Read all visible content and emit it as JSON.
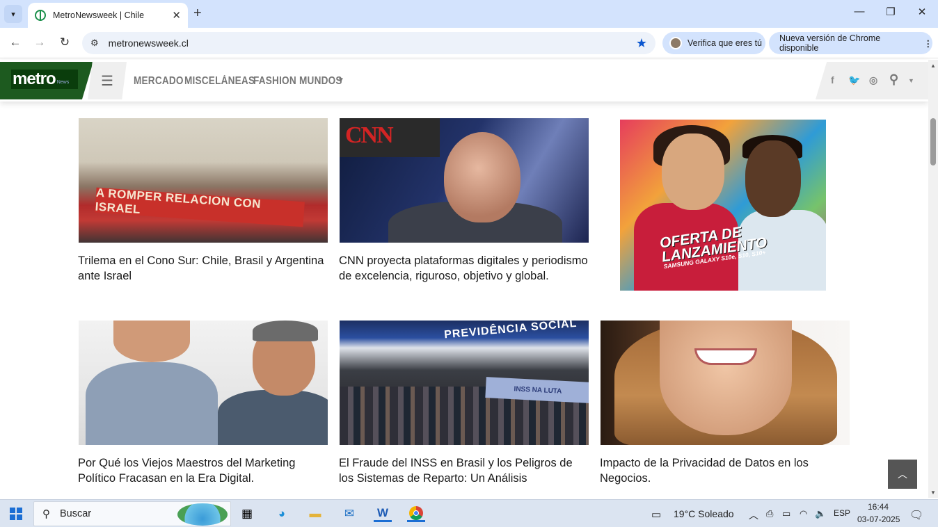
{
  "browser": {
    "tab_title": "MetroNewsweek | Chile",
    "url": "metronewsweek.cl",
    "verify_chip": "Verifica que eres tú",
    "update_chip": "Nueva versión de Chrome disponible"
  },
  "site": {
    "logo_main": "metro",
    "logo_sub": "News",
    "nav": [
      "MERCADO",
      "MISCELÁNEAS",
      "FASHION",
      "MUNDOS"
    ]
  },
  "articles": [
    {
      "title": "Trilema en el Cono Sur: Chile, Brasil y Argentina ante Israel",
      "banner_text": "A ROMPER RELACION CON ISRAEL"
    },
    {
      "title": "CNN proyecta plataformas digitales y periodismo de excelencia, riguroso, objetivo y global.",
      "logo_text": "CNN"
    },
    {
      "title": "Por Qué los Viejos Maestros del Marketing Político Fracasan en la Era Digital."
    },
    {
      "title": "El Fraude del INSS en Brasil y los Peligros de los Sistemas de Reparto: Un Análisis",
      "sign_text": "PREVIDÊNCIA SOCIAL",
      "banner_text": "INSS NA LUTA"
    },
    {
      "title": "Impacto de la Privacidad de Datos en los Negocios."
    }
  ],
  "ad": {
    "headline_1": "OFERTA DE",
    "headline_2": "LANZAMIENTO",
    "subline": "SAMSUNG GALAXY S10e, S10, S10+"
  },
  "taskbar": {
    "search_label": "Buscar",
    "weather": "19°C  Soleado",
    "language": "ESP",
    "time": "16:44",
    "date": "03-07-2025"
  },
  "colors": {
    "logo_green": "#1d5a1f",
    "tab_strip": "#d3e3fd",
    "star_blue": "#0b57d0"
  }
}
